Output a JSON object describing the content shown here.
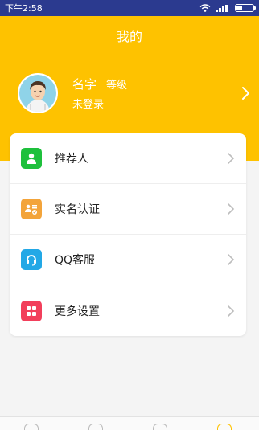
{
  "status_bar": {
    "time": "下午2:58"
  },
  "header": {
    "title": "我的",
    "name": "名字",
    "level": "等级",
    "login_status": "未登录"
  },
  "menu": [
    {
      "label": "推荐人",
      "icon": "person-icon",
      "color": "#1ec03c"
    },
    {
      "label": "实名认证",
      "icon": "id-card-icon",
      "color": "#f3a43a"
    },
    {
      "label": "QQ客服",
      "icon": "headset-icon",
      "color": "#22a8e6"
    },
    {
      "label": "更多设置",
      "icon": "grid-icon",
      "color": "#f23f5b"
    }
  ],
  "colors": {
    "accent": "#fec200",
    "status_bar": "#2b3a8f"
  }
}
